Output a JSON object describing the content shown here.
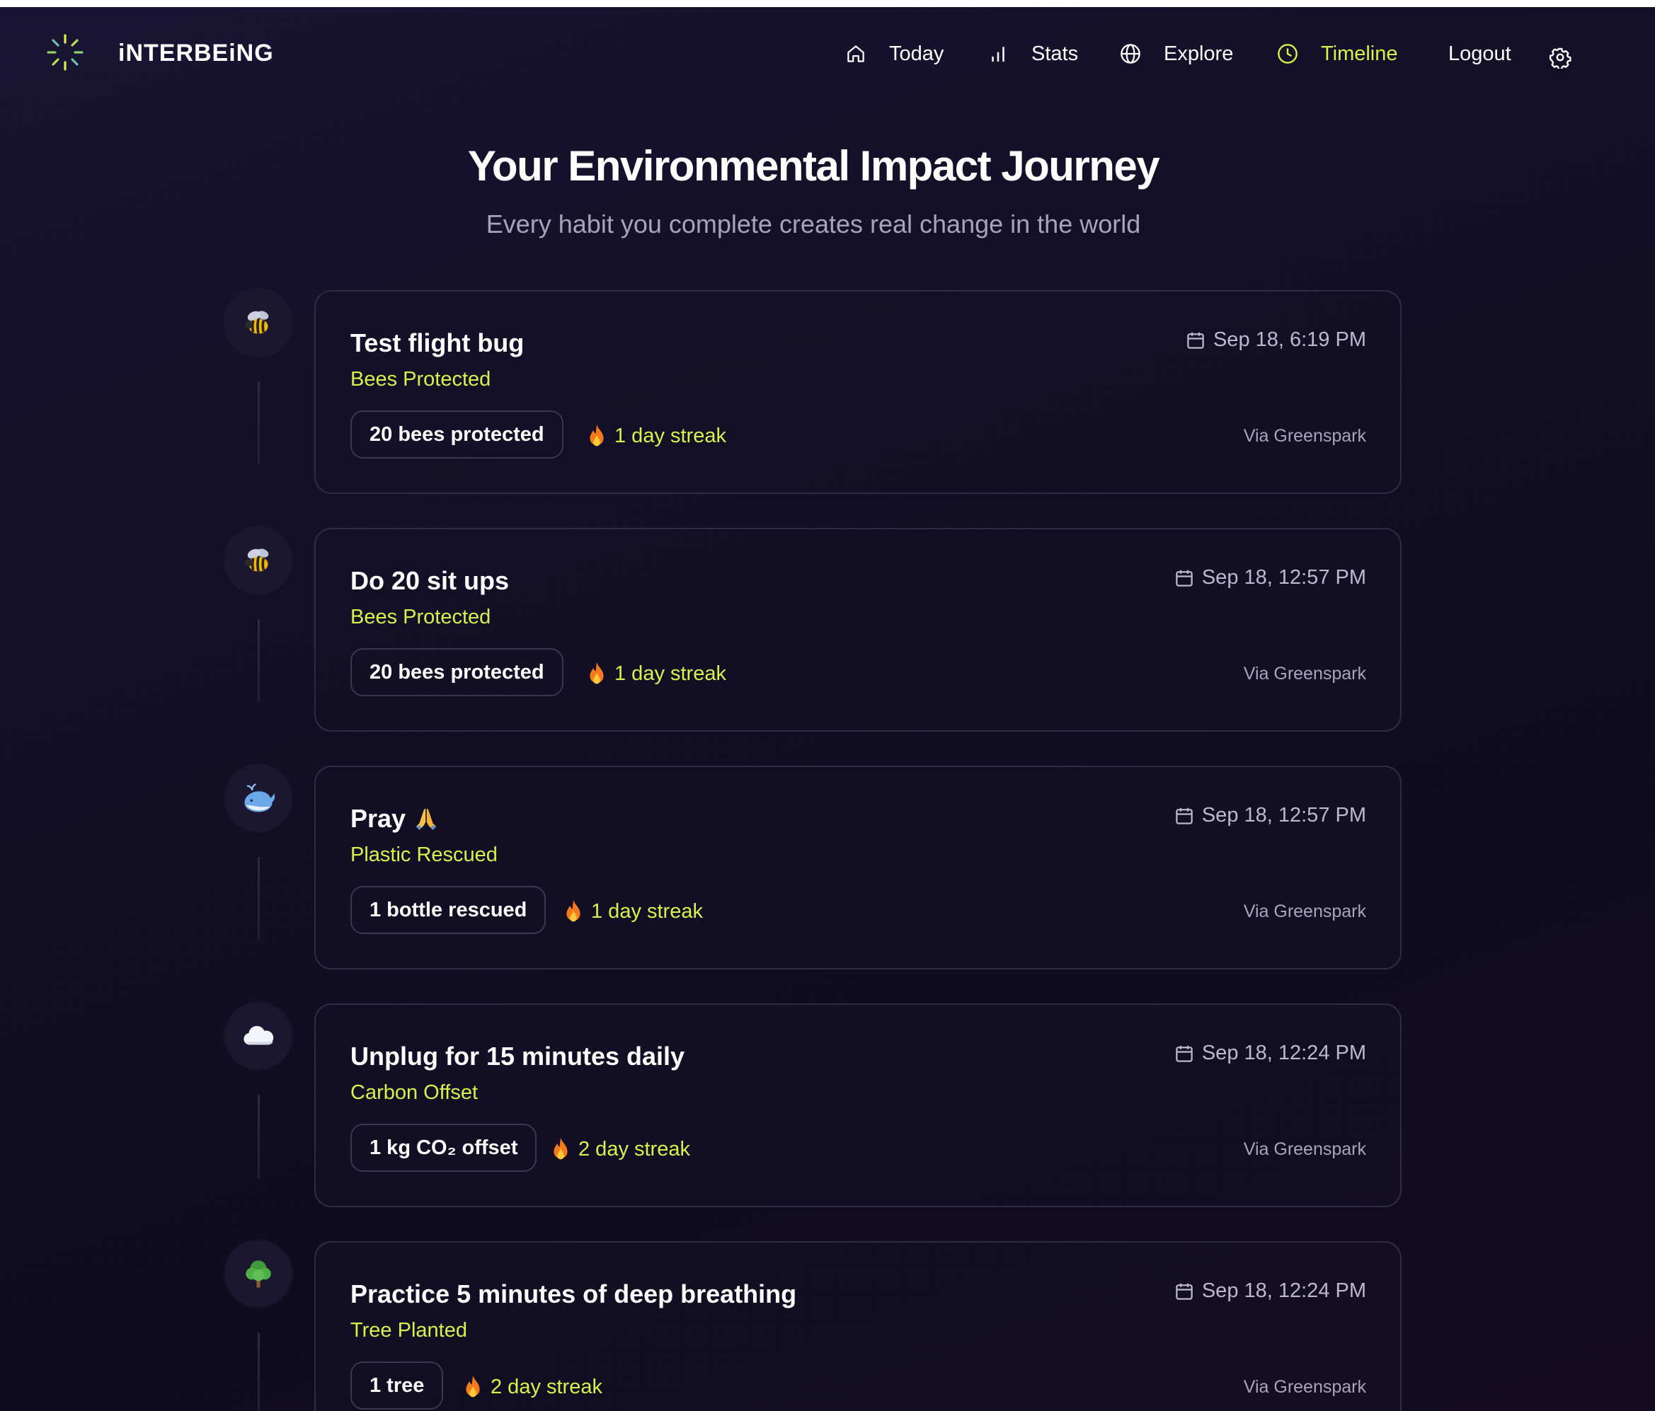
{
  "app": {
    "brand": "iNTERBEiNG"
  },
  "nav": {
    "items": [
      {
        "label": "Today",
        "icon": "home-icon"
      },
      {
        "label": "Stats",
        "icon": "bar-chart-icon"
      },
      {
        "label": "Explore",
        "icon": "globe-icon"
      },
      {
        "label": "Timeline",
        "icon": "clock-icon",
        "active": true
      },
      {
        "label": "Logout"
      }
    ],
    "settings_icon": "gear-icon",
    "accent_color": "#d7f24a"
  },
  "header": {
    "title": "Your Environmental Impact Journey",
    "subtitle": "Every habit you complete creates real change in the world"
  },
  "timeline": [
    {
      "icon": "bee-icon",
      "title": "Test flight bug",
      "category": "Bees Protected",
      "impact": "20 bees protected",
      "streak": "1 day streak",
      "date": "Sep 18, 6:19 PM",
      "via": "Via Greenspark"
    },
    {
      "icon": "bee-icon",
      "title": "Do 20 sit ups",
      "category": "Bees Protected",
      "impact": "20 bees protected",
      "streak": "1 day streak",
      "date": "Sep 18, 12:57 PM",
      "via": "Via Greenspark"
    },
    {
      "icon": "whale-icon",
      "title": "Pray",
      "title_emoji": "folded-hands-icon",
      "category": "Plastic Rescued",
      "impact": "1 bottle rescued",
      "streak": "1 day streak",
      "date": "Sep 18, 12:57 PM",
      "via": "Via Greenspark"
    },
    {
      "icon": "cloud-icon",
      "title": "Unplug for 15 minutes daily",
      "category": "Carbon Offset",
      "impact": "1 kg CO₂ offset",
      "streak": "2 day streak",
      "date": "Sep 18, 12:24 PM",
      "via": "Via Greenspark"
    },
    {
      "icon": "tree-icon",
      "title": "Practice 5 minutes of deep breathing",
      "category": "Tree Planted",
      "impact": "1 tree",
      "streak": "2 day streak",
      "date": "Sep 18, 12:24 PM",
      "via": "Via Greenspark"
    }
  ]
}
